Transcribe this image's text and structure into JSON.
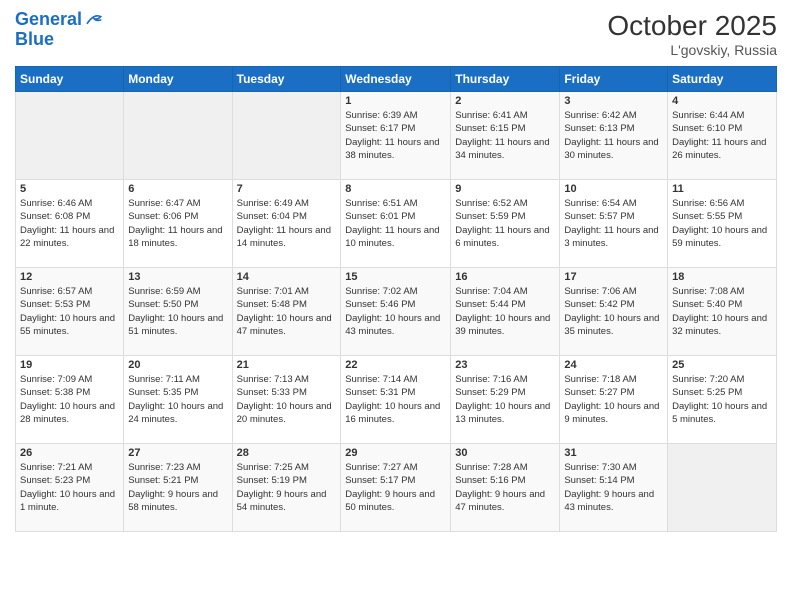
{
  "logo": {
    "line1": "General",
    "line2": "Blue"
  },
  "title": "October 2025",
  "location": "L'govskiy, Russia",
  "days_header": [
    "Sunday",
    "Monday",
    "Tuesday",
    "Wednesday",
    "Thursday",
    "Friday",
    "Saturday"
  ],
  "weeks": [
    [
      {
        "day": "",
        "empty": true
      },
      {
        "day": "",
        "empty": true
      },
      {
        "day": "",
        "empty": true
      },
      {
        "day": "1",
        "sunrise": "6:39 AM",
        "sunset": "6:17 PM",
        "daylight": "11 hours and 38 minutes."
      },
      {
        "day": "2",
        "sunrise": "6:41 AM",
        "sunset": "6:15 PM",
        "daylight": "11 hours and 34 minutes."
      },
      {
        "day": "3",
        "sunrise": "6:42 AM",
        "sunset": "6:13 PM",
        "daylight": "11 hours and 30 minutes."
      },
      {
        "day": "4",
        "sunrise": "6:44 AM",
        "sunset": "6:10 PM",
        "daylight": "11 hours and 26 minutes."
      }
    ],
    [
      {
        "day": "5",
        "sunrise": "6:46 AM",
        "sunset": "6:08 PM",
        "daylight": "11 hours and 22 minutes."
      },
      {
        "day": "6",
        "sunrise": "6:47 AM",
        "sunset": "6:06 PM",
        "daylight": "11 hours and 18 minutes."
      },
      {
        "day": "7",
        "sunrise": "6:49 AM",
        "sunset": "6:04 PM",
        "daylight": "11 hours and 14 minutes."
      },
      {
        "day": "8",
        "sunrise": "6:51 AM",
        "sunset": "6:01 PM",
        "daylight": "11 hours and 10 minutes."
      },
      {
        "day": "9",
        "sunrise": "6:52 AM",
        "sunset": "5:59 PM",
        "daylight": "11 hours and 6 minutes."
      },
      {
        "day": "10",
        "sunrise": "6:54 AM",
        "sunset": "5:57 PM",
        "daylight": "11 hours and 3 minutes."
      },
      {
        "day": "11",
        "sunrise": "6:56 AM",
        "sunset": "5:55 PM",
        "daylight": "10 hours and 59 minutes."
      }
    ],
    [
      {
        "day": "12",
        "sunrise": "6:57 AM",
        "sunset": "5:53 PM",
        "daylight": "10 hours and 55 minutes."
      },
      {
        "day": "13",
        "sunrise": "6:59 AM",
        "sunset": "5:50 PM",
        "daylight": "10 hours and 51 minutes."
      },
      {
        "day": "14",
        "sunrise": "7:01 AM",
        "sunset": "5:48 PM",
        "daylight": "10 hours and 47 minutes."
      },
      {
        "day": "15",
        "sunrise": "7:02 AM",
        "sunset": "5:46 PM",
        "daylight": "10 hours and 43 minutes."
      },
      {
        "day": "16",
        "sunrise": "7:04 AM",
        "sunset": "5:44 PM",
        "daylight": "10 hours and 39 minutes."
      },
      {
        "day": "17",
        "sunrise": "7:06 AM",
        "sunset": "5:42 PM",
        "daylight": "10 hours and 35 minutes."
      },
      {
        "day": "18",
        "sunrise": "7:08 AM",
        "sunset": "5:40 PM",
        "daylight": "10 hours and 32 minutes."
      }
    ],
    [
      {
        "day": "19",
        "sunrise": "7:09 AM",
        "sunset": "5:38 PM",
        "daylight": "10 hours and 28 minutes."
      },
      {
        "day": "20",
        "sunrise": "7:11 AM",
        "sunset": "5:35 PM",
        "daylight": "10 hours and 24 minutes."
      },
      {
        "day": "21",
        "sunrise": "7:13 AM",
        "sunset": "5:33 PM",
        "daylight": "10 hours and 20 minutes."
      },
      {
        "day": "22",
        "sunrise": "7:14 AM",
        "sunset": "5:31 PM",
        "daylight": "10 hours and 16 minutes."
      },
      {
        "day": "23",
        "sunrise": "7:16 AM",
        "sunset": "5:29 PM",
        "daylight": "10 hours and 13 minutes."
      },
      {
        "day": "24",
        "sunrise": "7:18 AM",
        "sunset": "5:27 PM",
        "daylight": "10 hours and 9 minutes."
      },
      {
        "day": "25",
        "sunrise": "7:20 AM",
        "sunset": "5:25 PM",
        "daylight": "10 hours and 5 minutes."
      }
    ],
    [
      {
        "day": "26",
        "sunrise": "7:21 AM",
        "sunset": "5:23 PM",
        "daylight": "10 hours and 1 minute."
      },
      {
        "day": "27",
        "sunrise": "7:23 AM",
        "sunset": "5:21 PM",
        "daylight": "9 hours and 58 minutes."
      },
      {
        "day": "28",
        "sunrise": "7:25 AM",
        "sunset": "5:19 PM",
        "daylight": "9 hours and 54 minutes."
      },
      {
        "day": "29",
        "sunrise": "7:27 AM",
        "sunset": "5:17 PM",
        "daylight": "9 hours and 50 minutes."
      },
      {
        "day": "30",
        "sunrise": "7:28 AM",
        "sunset": "5:16 PM",
        "daylight": "9 hours and 47 minutes."
      },
      {
        "day": "31",
        "sunrise": "7:30 AM",
        "sunset": "5:14 PM",
        "daylight": "9 hours and 43 minutes."
      },
      {
        "day": "",
        "empty": true
      }
    ]
  ]
}
